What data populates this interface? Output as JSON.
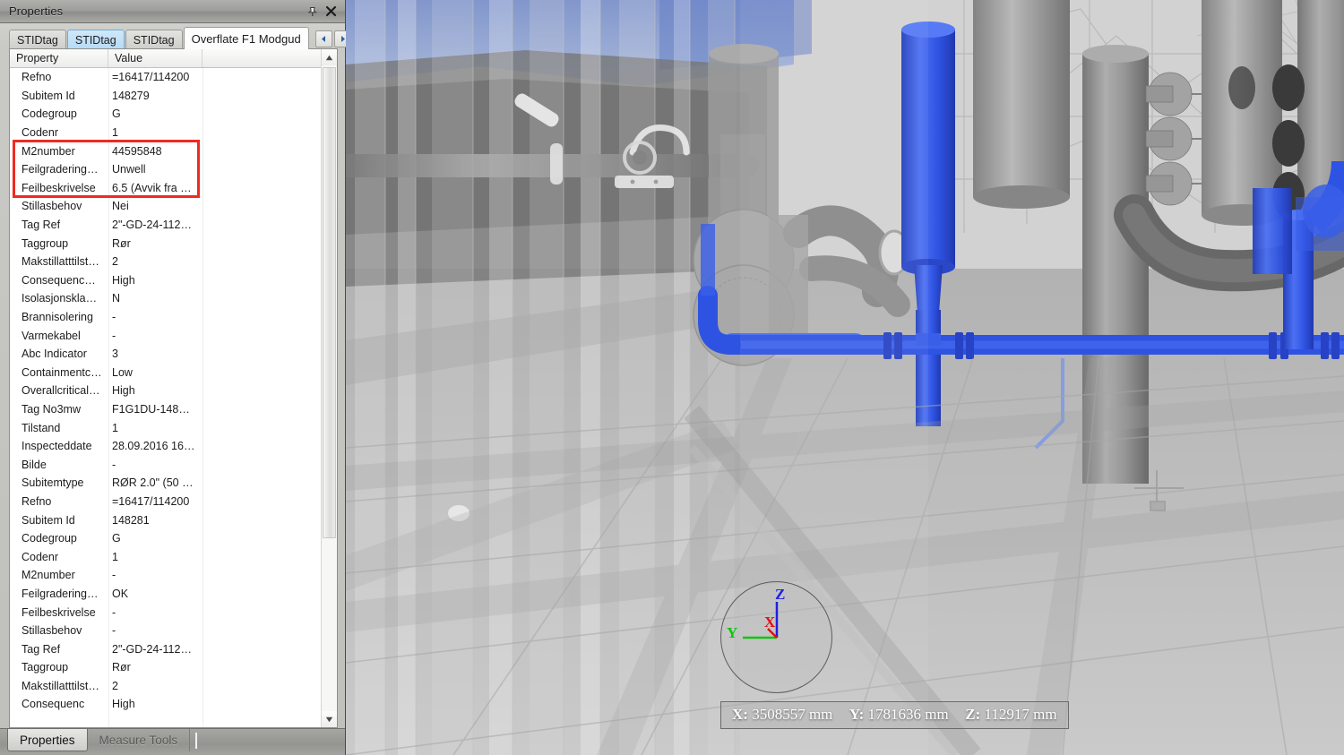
{
  "window": {
    "title": "Properties",
    "pin_icon": "pin-icon",
    "close_icon": "close-icon"
  },
  "tabs": {
    "items": [
      {
        "label": "STIDtag",
        "state": "normal"
      },
      {
        "label": "STIDtag",
        "state": "selected"
      },
      {
        "label": "STIDtag",
        "state": "normal"
      },
      {
        "label": "Overflate F1 Modgud",
        "state": "active"
      }
    ],
    "nav_prev_icon": "chevron-left-icon",
    "nav_next_icon": "chevron-right-icon"
  },
  "grid": {
    "headers": [
      "Property",
      "Value",
      ""
    ],
    "rows": [
      {
        "property": "Refno",
        "value": "=16417/114200"
      },
      {
        "property": "Subitem Id",
        "value": "148279"
      },
      {
        "property": "Codegroup",
        "value": "G"
      },
      {
        "property": "Codenr",
        "value": "1"
      },
      {
        "property": "M2number",
        "value": "44595848"
      },
      {
        "property": "Feilgradering…",
        "value": "Unwell"
      },
      {
        "property": "Feilbeskrivelse",
        "value": "6.5 (Avvik fra …"
      },
      {
        "property": "Stillasbehov",
        "value": "Nei"
      },
      {
        "property": "Tag Ref",
        "value": "2\"-GD-24-112…"
      },
      {
        "property": "Taggroup",
        "value": "Rør"
      },
      {
        "property": "Makstillatttilst…",
        "value": "2"
      },
      {
        "property": "Consequenc…",
        "value": "High"
      },
      {
        "property": "Isolasjonskla…",
        "value": "N"
      },
      {
        "property": "Brannisolering",
        "value": "-"
      },
      {
        "property": "Varmekabel",
        "value": "-"
      },
      {
        "property": "Abc Indicator",
        "value": "3"
      },
      {
        "property": "Containmentc…",
        "value": "Low"
      },
      {
        "property": "Overallcritical…",
        "value": "High"
      },
      {
        "property": "Tag No3mw",
        "value": "F1G1DU-148…"
      },
      {
        "property": "Tilstand",
        "value": "1"
      },
      {
        "property": "Inspecteddate",
        "value": "28.09.2016 16…"
      },
      {
        "property": "Bilde",
        "value": "-"
      },
      {
        "property": "Subitemtype",
        "value": "RØR 2.0\" (50 …"
      },
      {
        "property": "Refno",
        "value": "=16417/114200"
      },
      {
        "property": "Subitem Id",
        "value": "148281"
      },
      {
        "property": "Codegroup",
        "value": "G"
      },
      {
        "property": "Codenr",
        "value": "1"
      },
      {
        "property": "M2number",
        "value": "-"
      },
      {
        "property": "Feilgradering…",
        "value": "OK"
      },
      {
        "property": "Feilbeskrivelse",
        "value": "-"
      },
      {
        "property": "Stillasbehov",
        "value": "-"
      },
      {
        "property": "Tag Ref",
        "value": "2\"-GD-24-112…"
      },
      {
        "property": "Taggroup",
        "value": "Rør"
      },
      {
        "property": "Makstillatttilst…",
        "value": "2"
      },
      {
        "property": "Consequenc",
        "value": "High"
      }
    ],
    "highlight": {
      "color": "#ee2b22",
      "first_row_index": 4,
      "row_count": 3
    },
    "scrollbar": {
      "up_icon": "scroll-up-arrow-icon",
      "down_icon": "scroll-down-arrow-icon",
      "thumb_position_percent": 0,
      "thumb_size_percent": 73
    }
  },
  "dock_tabs": {
    "items": [
      {
        "label": "Properties",
        "active": true
      },
      {
        "label": "Measure Tools",
        "active": false
      }
    ]
  },
  "viewport": {
    "gizmo": {
      "axis_z_label": "Z",
      "axis_x_label": "X",
      "axis_y_label": "Y",
      "color_z": "#1f1fe0",
      "color_x": "#e01010",
      "color_y": "#11c411"
    },
    "coordinates": {
      "x_label": "X:",
      "x_value": "3508557",
      "x_unit": "mm",
      "y_label": "Y:",
      "y_value": "1781636",
      "y_unit": "mm",
      "z_label": "Z:",
      "z_value": "112917",
      "z_unit": "mm"
    },
    "colors": {
      "highlight_pipe": "#1f46e0",
      "sky": "#7e95cc",
      "model_grey": "#8e8e8e",
      "background": "#b2b2b2"
    }
  }
}
